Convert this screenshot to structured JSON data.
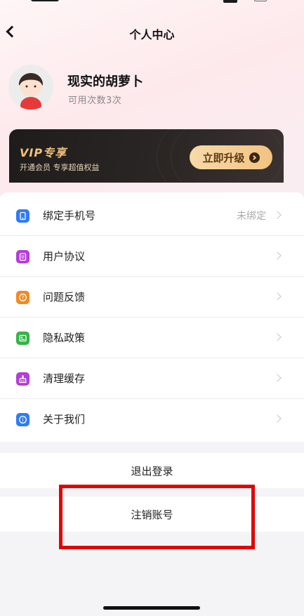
{
  "header": {
    "title": "个人中心"
  },
  "profile": {
    "name": "现实的胡萝卜",
    "credits": "可用次数3次"
  },
  "vip": {
    "title": "VIP专享",
    "subtitle": "开通会员 专享超值权益",
    "button_label": "立即升级"
  },
  "menu": {
    "items": [
      {
        "label": "绑定手机号",
        "value": "未绑定",
        "icon": "phone-icon",
        "color": "#2f7bf6"
      },
      {
        "label": "用户协议",
        "value": "",
        "icon": "clipboard-icon",
        "color": "#b53dd8"
      },
      {
        "label": "问题反馈",
        "value": "",
        "icon": "question-icon",
        "color": "#f08a24"
      },
      {
        "label": "隐私政策",
        "value": "",
        "icon": "id-card-icon",
        "color": "#35b34a"
      },
      {
        "label": "清理缓存",
        "value": "",
        "icon": "broom-icon",
        "color": "#b53dd8"
      },
      {
        "label": "关于我们",
        "value": "",
        "icon": "info-icon",
        "color": "#2f7bf6"
      }
    ]
  },
  "actions": {
    "logout_label": "退出登录",
    "delete_account_label": "注销账号"
  },
  "colors": {
    "highlight": "#e30000",
    "vip_gold": "#f1c27c",
    "vip_dark": "#1e1c1b"
  }
}
